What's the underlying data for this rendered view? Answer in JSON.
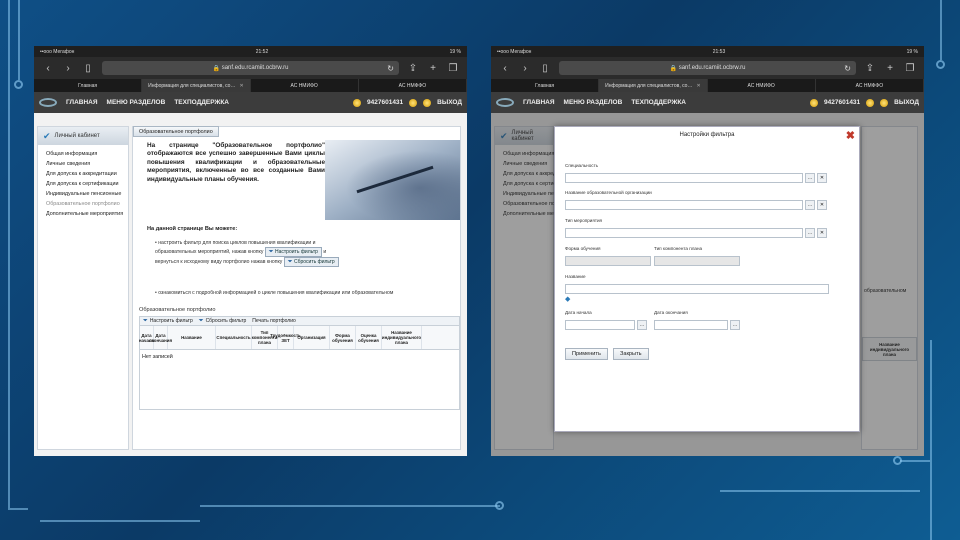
{
  "left": {
    "status": {
      "carrier": "••ooo Мегафон",
      "time": "21:52",
      "battery": "19 %"
    },
    "url": "sanf.edu.rcamiit.ocbrw.ru",
    "tabs": [
      {
        "label": "Главная",
        "active": false
      },
      {
        "label": "Информация для специалистов, со…",
        "active": true
      },
      {
        "label": "АС НМИФО",
        "active": false
      },
      {
        "label": "АС НМФФО",
        "active": false
      }
    ],
    "site_nav": {
      "home": "ГЛАВНАЯ",
      "sections": "МЕНЮ РАЗДЕЛОВ",
      "support": "ТЕХПОДДЕРЖКА",
      "phone": "9427601431",
      "logout": "ВЫХОД"
    },
    "sidebar": {
      "title": "Личный кабинет",
      "items": [
        "Общая информация",
        "Личные сведения",
        "Для допуска к аккредитации",
        "Для допуска к сертификации",
        "Индивидуальные пенсионные",
        "Образовательное портфолио",
        "Дополнительные мероприятия"
      ]
    },
    "main_tab": "Образовательное портфолио",
    "intro": "На странице \"Образовательное портфолио\" отображаются все успешно завершенные Вами циклы повышения квалификации и образовательные мероприятия, включенные во все созданные Вами индивидуальные планы обучения.",
    "on_page": "На данной странице Вы можете:",
    "bullet1_a": "настроить фильтр для поиска циклов повышения квалификации и образовательных мероприятий, нажав кнопку",
    "bullet1_btn1": "Настроить фильтр",
    "bullet1_b": "и вернуться к исходному виду портфолио нажав кнопку",
    "bullet1_btn2": "Сбросить фильтр",
    "bullet2": "ознакомиться с подробной информацией о цикле повышения квалификации или образовательном",
    "portfolio": {
      "title": "Образовательное портфолио",
      "toolbar": [
        "Настроить фильтр",
        "Сбросить фильтр",
        "Печать портфолио"
      ],
      "columns": [
        "Дата начала",
        "Дата окончания",
        "Название",
        "Специальность",
        "Тип компонента плана",
        "Трудоёмкость ЗЕТ",
        "Организация",
        "Форма обучения",
        "Оценка обучения",
        "Название индивидуального плана"
      ],
      "empty": "Нет записей"
    }
  },
  "right": {
    "status": {
      "carrier": "••ooo Мегафон",
      "time": "21:53",
      "battery": "19 %"
    },
    "url": "sanf.edu.rcamiit.ocbrw.ru",
    "tabs": [
      {
        "label": "Главная",
        "active": false
      },
      {
        "label": "Информация для специалистов, со…",
        "active": true
      },
      {
        "label": "АС НМИФО",
        "active": false
      },
      {
        "label": "АС НМФФО",
        "active": false
      }
    ],
    "site_nav": {
      "home": "ГЛАВНАЯ",
      "sections": "МЕНЮ РАЗДЕЛОВ",
      "support": "ТЕХПОДДЕРЖКА",
      "phone": "9427601431",
      "logout": "ВЫХОД"
    },
    "bg_fragment": "образовательном",
    "bg_column": "Название индивидуального плана",
    "modal": {
      "title": "Настройки фильтра",
      "specialty_label": "Специальность",
      "organization_label": "Название образовательной организации",
      "type_label": "Тип мероприятия",
      "form_label": "Форма обучения",
      "component_label": "Тип компонента плана",
      "name_label": "Название",
      "date_start_label": "Дата начала",
      "date_end_label": "Дата окончания",
      "apply": "Применить",
      "close": "Закрыть"
    }
  }
}
